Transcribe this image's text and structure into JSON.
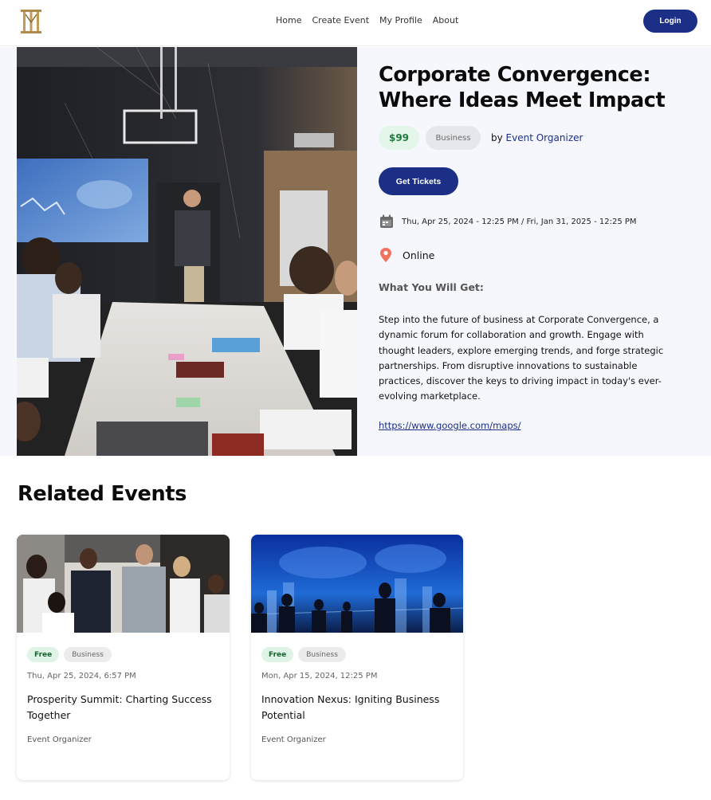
{
  "header": {
    "nav": [
      "Home",
      "Create Event",
      "My Profile",
      "About"
    ],
    "login_label": "Login"
  },
  "event": {
    "title": "Corporate Convergence: Where Ideas Meet Impact",
    "price": "$99",
    "category": "Business",
    "by_prefix": "by",
    "organizer": "Event Organizer",
    "tickets_label": "Get Tickets",
    "dates": "Thu, Apr 25, 2024 - 12:25 PM / Fri, Jan 31, 2025 - 12:25 PM",
    "location": "Online",
    "what_you_get": "What You Will Get:",
    "description": "Step into the future of business at Corporate Convergence, a dynamic forum for collaboration and growth. Engage with thought leaders, explore emerging trends, and forge strategic partnerships. From disruptive innovations to sustainable practices, discover the keys to driving impact in today's ever-evolving marketplace.",
    "link": "https://www.google.com/maps/"
  },
  "related": {
    "title": "Related Events",
    "cards": [
      {
        "price": "Free",
        "category": "Business",
        "date": "Thu, Apr 25, 2024, 6:57 PM",
        "title": "Prosperity Summit: Charting Success Together",
        "organizer": "Event Organizer"
      },
      {
        "price": "Free",
        "category": "Business",
        "date": "Mon, Apr 15, 2024, 12:25 PM",
        "title": "Innovation Nexus: Igniting Business Potential",
        "organizer": "Event Organizer"
      }
    ]
  },
  "colors": {
    "brand": "#1b2f86",
    "price_bg": "#e4f5ea",
    "price_text": "#1d7a3d",
    "location_pin": "#f0725f",
    "hero_bg": "#f6f7fd"
  }
}
